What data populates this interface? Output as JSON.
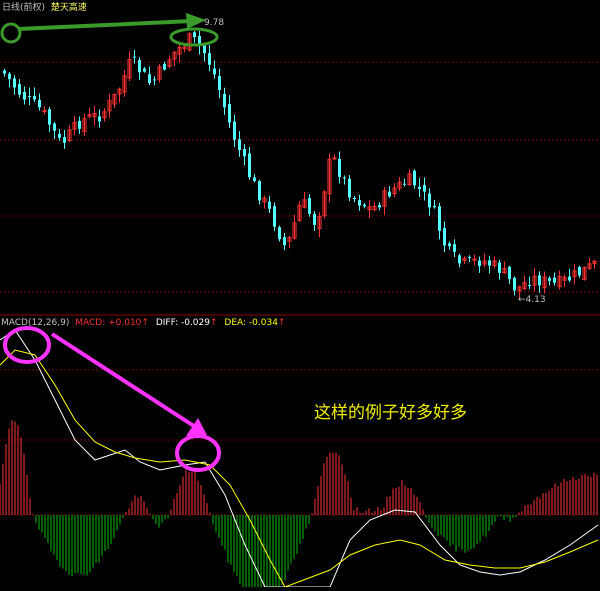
{
  "header": {
    "title": "日线(前权)",
    "stock_name": "楚天高速",
    "high_label": "9.78",
    "low_label": "4.13"
  },
  "macd": {
    "label": "MACD(12,26,9)",
    "macd_text": "MACD: +0.010",
    "diff_text": "DIFF: -0.029",
    "dea_text": "DEA: -0.034"
  },
  "annotation": "这样的例子好多好多",
  "colors": {
    "up": "#ff3232",
    "down": "#54ffff",
    "histogram_up": "#ff3232",
    "histogram_down": "#00c000",
    "diff_line": "#ffffff",
    "dea_line": "#ffff00",
    "grid": "#7a0000",
    "green_marker": "#3a9a2a",
    "pink_marker": "#ff33ff",
    "label_text": "#c0c0c0"
  }
}
